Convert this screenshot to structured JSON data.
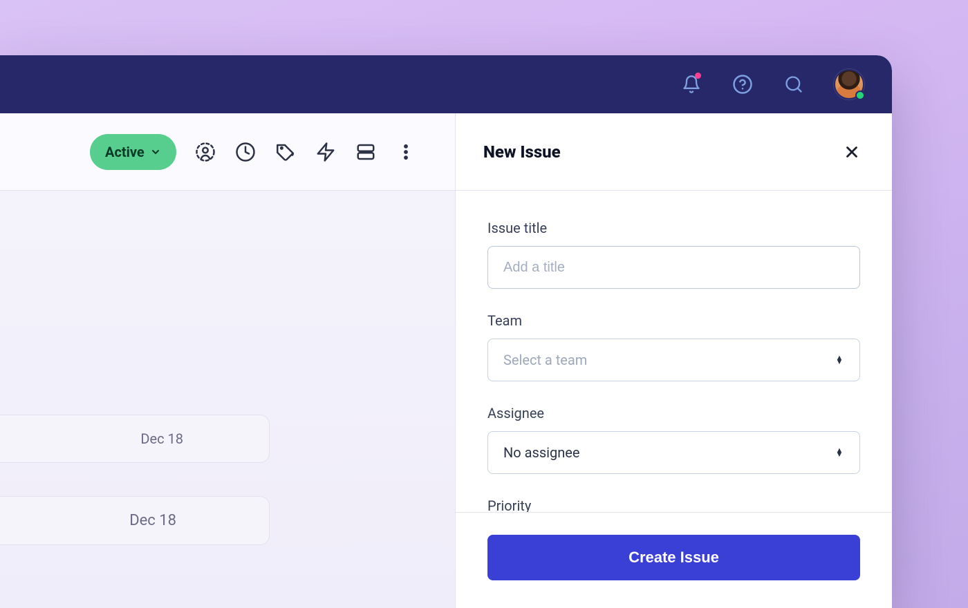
{
  "toolbar": {
    "filter_chip_label": "Active"
  },
  "background": {
    "card1_date": "Dec 18",
    "card2_date": "Dec 18"
  },
  "panel": {
    "title": "New Issue",
    "fields": {
      "title_label": "Issue title",
      "title_placeholder": "Add a title",
      "team_label": "Team",
      "team_placeholder": "Select a team",
      "assignee_label": "Assignee",
      "assignee_value": "No assignee",
      "priority_label": "Priority"
    },
    "submit_label": "Create Issue"
  }
}
